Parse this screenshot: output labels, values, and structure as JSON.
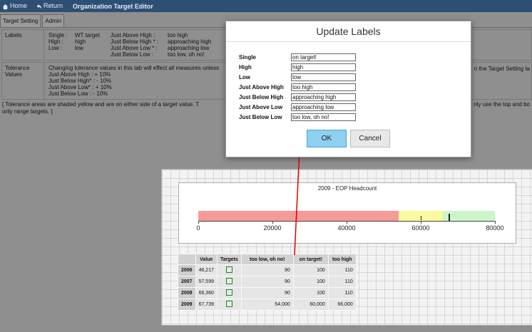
{
  "topbar": {
    "home": "Home",
    "return": "Return",
    "title": "Organization Target Editor"
  },
  "tabs": [
    "Target Setting",
    "Admin"
  ],
  "settings": {
    "labels_title": "Labels",
    "labels": [
      {
        "k": "Single :",
        "v": "WT target",
        "k2": "Just Above High :",
        "v2": "too high"
      },
      {
        "k": "High :",
        "v": "high",
        "k2": "Just Below High * :",
        "v2": "approaching high"
      },
      {
        "k": "Low :",
        "v": "low",
        "k2": "Just Above Low * :",
        "v2": "approaching low"
      },
      {
        "k": "",
        "v": "",
        "k2": "Just Below Low :",
        "v2": "too low, oh no!"
      }
    ],
    "tolerance_title": "Tolerance Values",
    "tolerance_intro": "Changing tolerance values in this tab will effect all measures unless",
    "tolerance_cutoff": "n the Target Setting ta",
    "tolerance_lines": [
      "Just Above High   : + 10%",
      "Just Below High* : - 10%",
      "Just Above Low*  : + 10%",
      "Just Below Low    : - 10%"
    ],
    "note_line1": "[ Tolerance areas are shaded yellow and are on either side of a target value. T",
    "note_line1_end": "nly use the top and bo",
    "note_line2": "only range targets. ]"
  },
  "chart_data": {
    "type": "bullet",
    "title": "2009 - EOP Headcount",
    "xlim": [
      0,
      80000
    ],
    "ticks": [
      0,
      20000,
      40000,
      60000,
      80000
    ],
    "tick_labels": [
      "0",
      "20000",
      "40000",
      "60000",
      "80000"
    ],
    "bands": [
      {
        "from": 0,
        "to": 54000,
        "color": "#f79a9a"
      },
      {
        "from": 54000,
        "to": 66000,
        "color": "#fafaa0"
      },
      {
        "from": 66000,
        "to": 80000,
        "color": "#ccf5cc"
      }
    ],
    "value": 67739,
    "target": 60000
  },
  "table": {
    "headers": [
      "",
      "Value",
      "Targets",
      "too low, oh no!",
      "on target!",
      "too high"
    ],
    "rows": [
      {
        "year": "2006",
        "value": "46,217",
        "low": "90",
        "on": "100",
        "high": "110"
      },
      {
        "year": "2007",
        "value": "57,599",
        "low": "90",
        "on": "100",
        "high": "110"
      },
      {
        "year": "2008",
        "value": "66,360",
        "low": "90",
        "on": "100",
        "high": "110"
      },
      {
        "year": "2009",
        "value": "67,739",
        "low": "54,000",
        "on": "60,000",
        "high": "66,000"
      }
    ]
  },
  "modal": {
    "title": "Update Labels",
    "fields": [
      {
        "label": "Single",
        "value": "on target!"
      },
      {
        "label": "High",
        "value": "high"
      },
      {
        "label": "Low",
        "value": "low"
      },
      {
        "label": "Just Above High",
        "value": "too high"
      },
      {
        "label": "Just Below High",
        "value": "approaching high"
      },
      {
        "label": "Just Above Low",
        "value": "approaching low"
      },
      {
        "label": "Just Below Low",
        "value": "too low, oh no!"
      }
    ],
    "ok": "OK",
    "cancel": "Cancel"
  },
  "colors": {
    "topbar": "#2e4f74",
    "overlay": "#8f8f8f",
    "connector": "#e00000",
    "ok_button": "#8ed0ef"
  }
}
